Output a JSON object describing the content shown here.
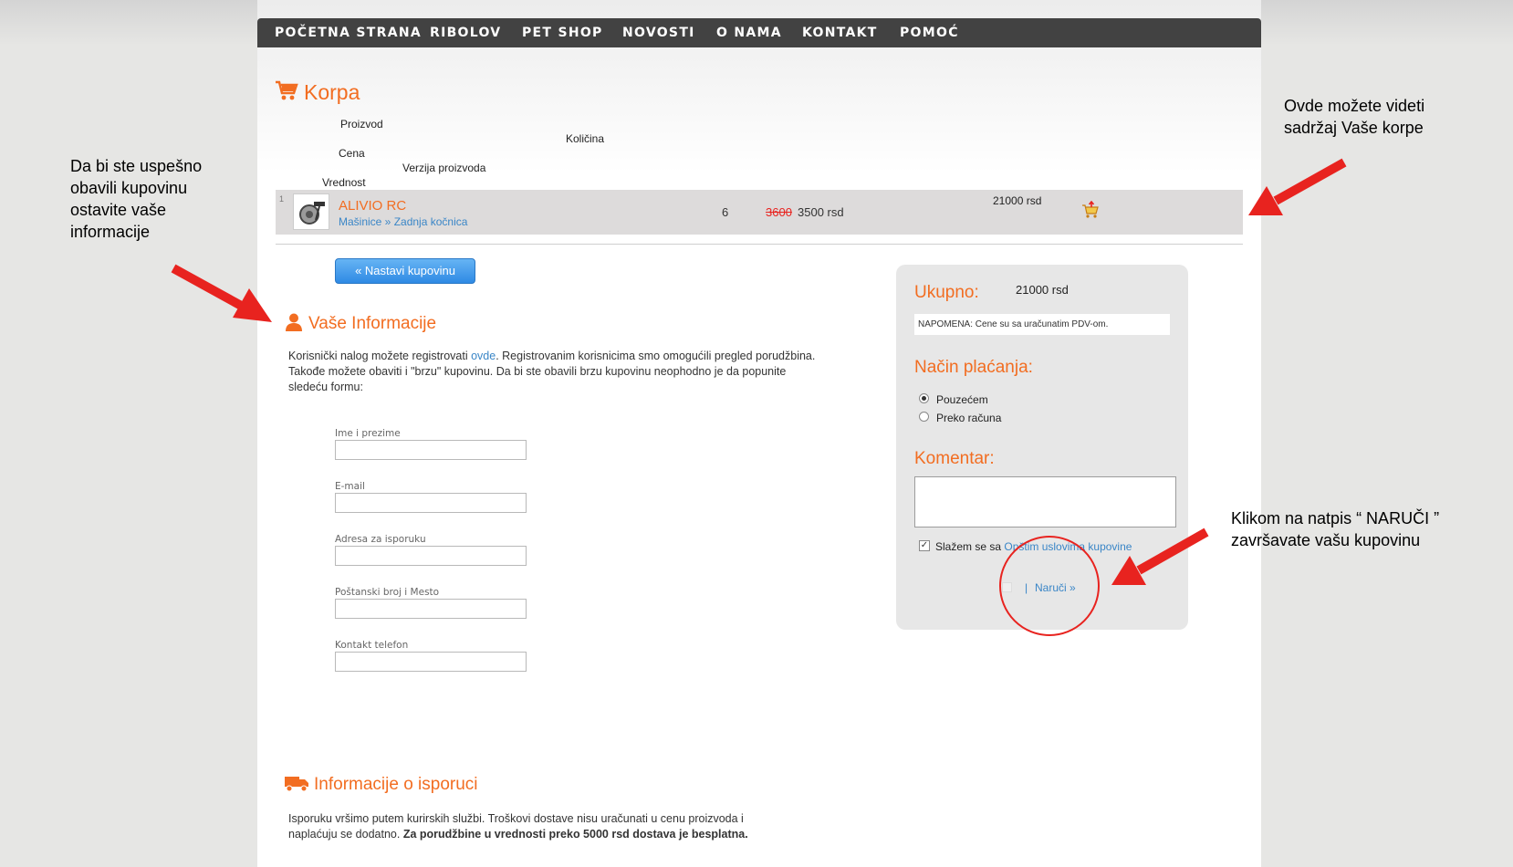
{
  "nav": {
    "items": [
      "POČETNA STRANA",
      "RIBOLOV",
      "PET SHOP",
      "NOVOSTI",
      "O NAMA",
      "KONTAKT",
      "POMOĆ"
    ]
  },
  "cart": {
    "title": "Korpa",
    "headers": {
      "product": "Proizvod",
      "quantity": "Količina",
      "price": "Cena",
      "version": "Verzija proizvoda",
      "value": "Vrednost"
    },
    "item": {
      "index": "1",
      "name": "ALIVIO RC",
      "category": "Mašinice » Zadnja kočnica",
      "quantity": "6",
      "old_price": "3600",
      "price": "3500 rsd",
      "total": "21000 rsd"
    }
  },
  "actions": {
    "continue": "« Nastavi kupovinu"
  },
  "info": {
    "title": "Vaše Informacije",
    "text_before_link": "Korisnički nalog možete registrovati ",
    "link": "ovde",
    "text_after_link": ". Registrovanim korisnicima smo omogućili pregled porudžbina. Takođe možete obaviti i \"brzu\" kupovinu. Da bi ste obavili brzu kupovinu neophodno je da popunite sledeću formu:",
    "fields": [
      "Ime i prezime",
      "E-mail",
      "Adresa za isporuku",
      "Poštanski broj i Mesto",
      "Kontakt telefon"
    ]
  },
  "delivery": {
    "title": "Informacije o isporuci",
    "text": "Isporuku vršimo putem kurirskih službi. Troškovi dostave nisu uračunati u cenu proizvoda i naplaćuju se dodatno.",
    "bold": "Za porudžbine u vrednosti preko 5000 rsd dostava je besplatna."
  },
  "summary": {
    "total_label": "Ukupno:",
    "total_value": "21000 rsd",
    "note": "NAPOMENA: Cene su sa uračunatim PDV-om.",
    "payment_label": "Način plaćanja:",
    "payment_options": [
      "Pouzećem",
      "Preko računa"
    ],
    "payment_selected": 0,
    "comment_label": "Komentar:",
    "agree_prefix": "Slažem se sa ",
    "agree_link": "Opštim uslovima kupovine",
    "agree_checked": true,
    "order_sep": "|",
    "order_label": "Naruči »"
  },
  "callouts": {
    "left": "Da bi ste uspešno obavili kupovinu ostavite vaše informacije",
    "top_right": "Ovde možete videti sadržaj Vaše korpe",
    "bottom_right": "Klikom na natpis “ NARUČI ” završavate vašu kupovinu"
  },
  "colors": {
    "accent": "#f26d21",
    "link": "#3a86c7",
    "nav_bg": "#424242",
    "arrow": "#e8231f"
  }
}
